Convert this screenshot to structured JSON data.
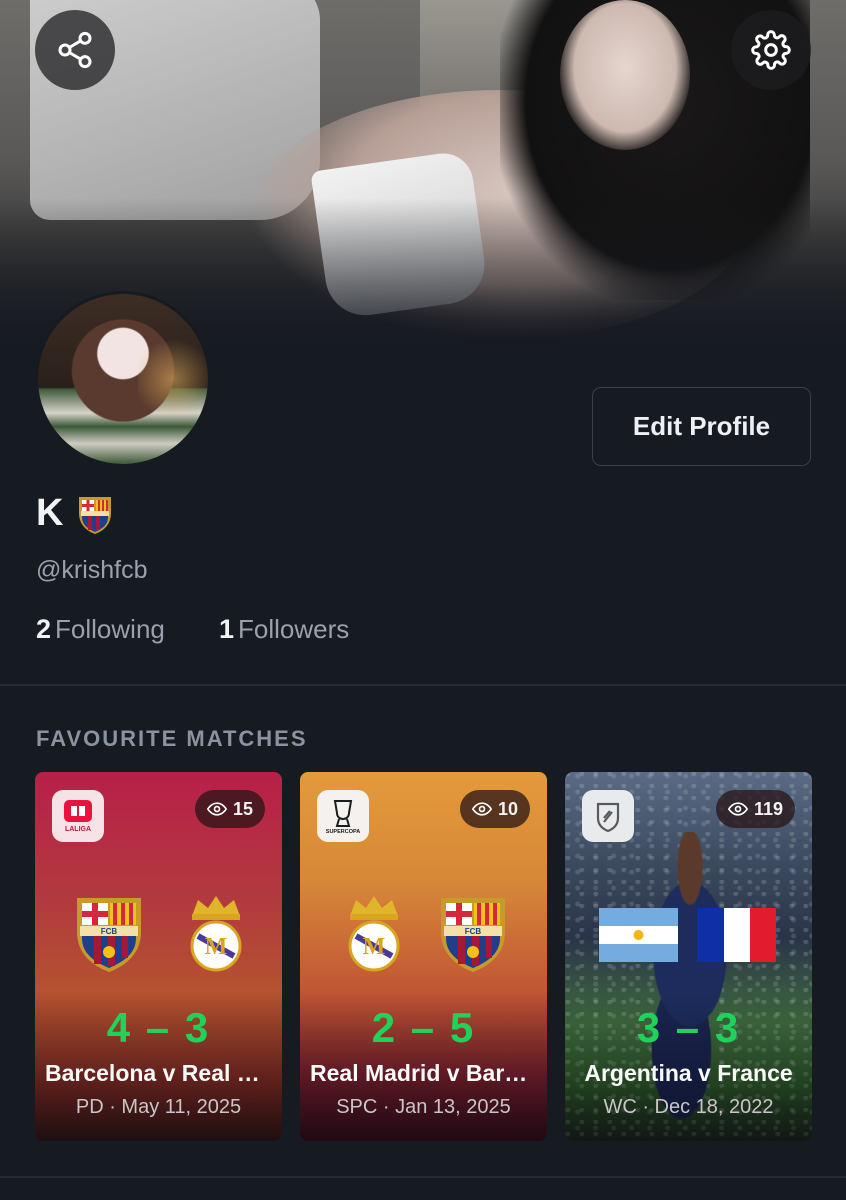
{
  "profile": {
    "name": "K",
    "handle": "@krishfcb",
    "following_count": "2",
    "following_label": "Following",
    "followers_count": "1",
    "followers_label": "Followers",
    "edit_label": "Edit Profile"
  },
  "icons": {
    "share": "share-icon",
    "settings": "gear-icon",
    "views": "eye-icon",
    "name_badge": "fc-barcelona-crest-icon"
  },
  "section": {
    "title": "FAVOURITE MATCHES"
  },
  "matches": [
    {
      "league_logo": "LALIGA",
      "views": "15",
      "home": "fc-barcelona-crest",
      "away": "real-madrid-crest",
      "score": "4 – 3",
      "title": "Barcelona v Real Madrid",
      "meta": "PD · May 11, 2025"
    },
    {
      "league_logo": "SUPERCOPA",
      "views": "10",
      "home": "real-madrid-crest",
      "away": "fc-barcelona-crest",
      "score": "2 – 5",
      "title": "Real Madrid v Barcelona",
      "meta": "SPC · Jan 13, 2025"
    },
    {
      "league_logo": "shield-icon",
      "views": "119",
      "home": "argentina-flag",
      "away": "france-flag",
      "score": "3 – 3",
      "title": "Argentina v France",
      "meta": "WC · Dec 18, 2022"
    }
  ],
  "colors": {
    "background": "#161a21",
    "score_green": "#1fd35a",
    "muted_text": "#9aa1ab"
  }
}
